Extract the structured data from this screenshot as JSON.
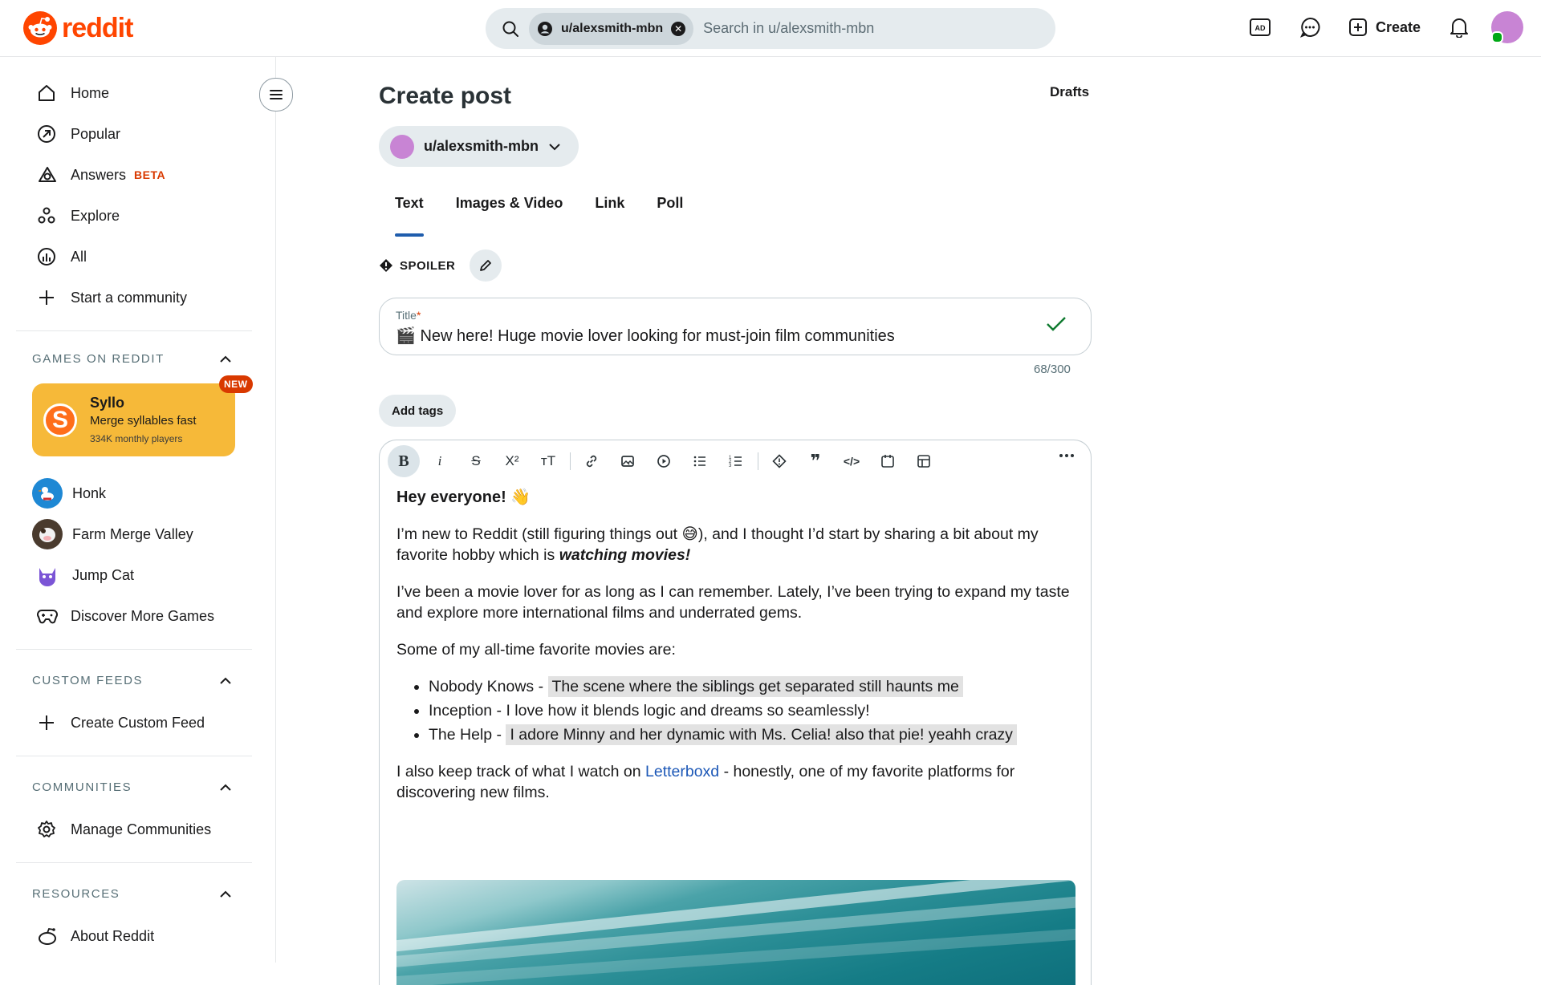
{
  "header": {
    "logo_text": "reddit",
    "search_chip": "u/alexsmith-mbn",
    "search_placeholder": "Search in u/alexsmith-mbn",
    "create_label": "Create"
  },
  "sidebar": {
    "nav": [
      {
        "label": "Home"
      },
      {
        "label": "Popular"
      },
      {
        "label": "Answers",
        "badge": "BETA"
      },
      {
        "label": "Explore"
      },
      {
        "label": "All"
      },
      {
        "label": "Start a community"
      }
    ],
    "games_header": "GAMES ON REDDIT",
    "featured_game": {
      "name": "Syllo",
      "tagline": "Merge syllables fast",
      "players": "334K monthly players",
      "badge": "NEW",
      "logo_letter": "S"
    },
    "games": [
      {
        "label": "Honk"
      },
      {
        "label": "Farm Merge Valley"
      },
      {
        "label": "Jump Cat"
      },
      {
        "label": "Discover More Games"
      }
    ],
    "custom_feeds_header": "CUSTOM FEEDS",
    "create_custom_feed": "Create Custom Feed",
    "communities_header": "COMMUNITIES",
    "manage_communities": "Manage Communities",
    "resources_header": "RESOURCES",
    "about_reddit": "About Reddit"
  },
  "main": {
    "page_title": "Create post",
    "drafts_label": "Drafts",
    "post_as": "u/alexsmith-mbn",
    "tabs": [
      {
        "label": "Text",
        "active": true
      },
      {
        "label": "Images & Video"
      },
      {
        "label": "Link"
      },
      {
        "label": "Poll"
      }
    ],
    "spoiler_label": "SPOILER",
    "title_field": {
      "label": "Title",
      "required_mark": "*",
      "value": "🎬 New here! Huge movie lover looking for must-join film communities",
      "char_count": "68/300"
    },
    "add_tags_label": "Add tags",
    "body": {
      "heading": "Hey everyone! 👋",
      "p1_pre": "I’m new to Reddit (still figuring things out 😅), and I thought I’d start by sharing a bit about my favorite hobby which is ",
      "p1_emph": "watching movies!",
      "p2": "I’ve been a movie lover for as long as I can remember. Lately, I’ve been trying to expand my taste and explore more international films and underrated gems.",
      "p3": "Some of my all-time favorite movies are:",
      "list": [
        {
          "title": "Nobody Knows - ",
          "note": "The scene where the siblings get separated still haunts me"
        },
        {
          "title": "Inception - I love how it blends logic and dreams so seamlessly!",
          "note": ""
        },
        {
          "title": "The Help - ",
          "note": "I adore Minny and her dynamic with Ms. Celia! also that pie! yeahh crazy"
        }
      ],
      "p4_pre": "I also keep track of what I watch on ",
      "p4_link": "Letterboxd",
      "p4_post": " - honestly, one of my favorite platforms for discovering new films."
    }
  },
  "colors": {
    "brand": "#ff4500",
    "tab_underline": "#1f5dad",
    "link": "#1d58b7",
    "featured_game_bg": "#f6b939"
  }
}
